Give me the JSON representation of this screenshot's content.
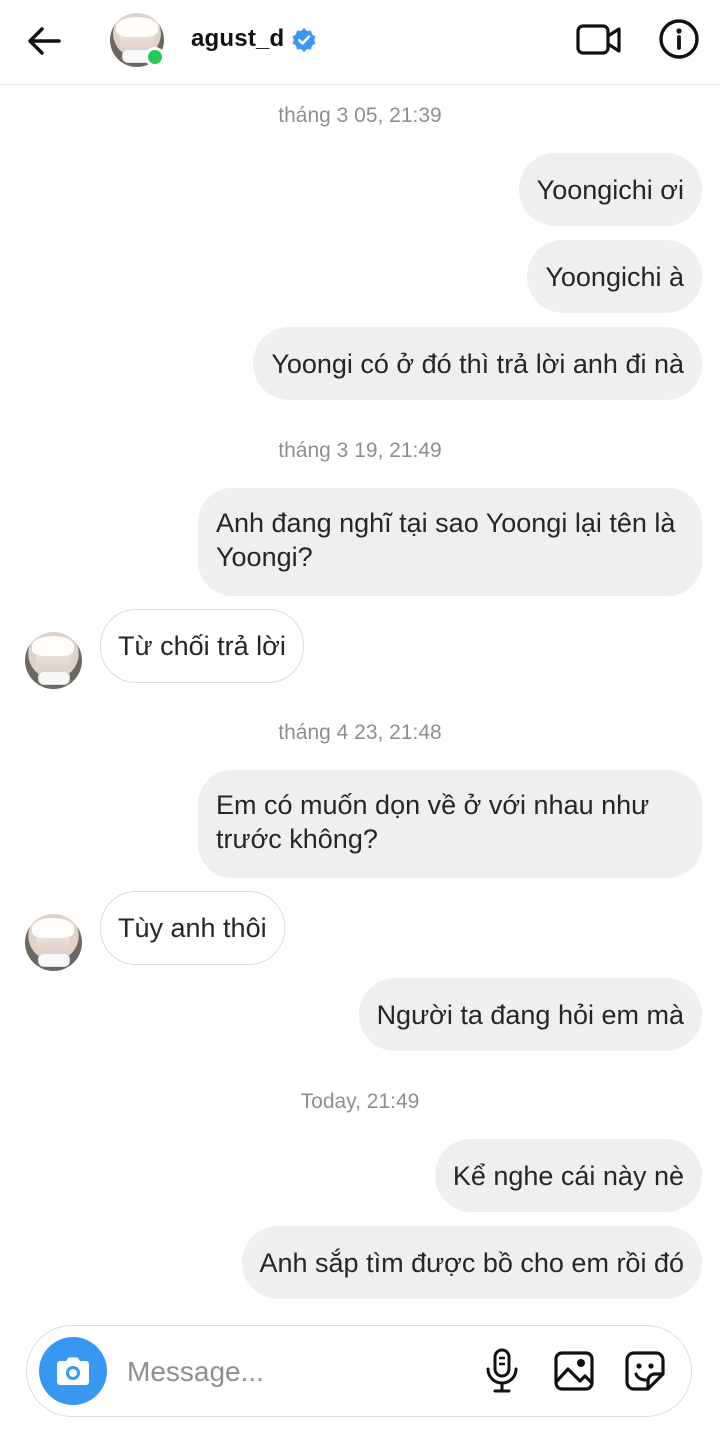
{
  "header": {
    "back_icon": "arrow-left-icon",
    "username": "agust_d",
    "verified_icon": "verified-badge-icon",
    "online_status_color": "#28c654",
    "video_icon": "video-camera-icon",
    "info_icon": "info-icon"
  },
  "conversation": [
    {
      "kind": "timestamp",
      "text": "tháng 3 05, 21:39"
    },
    {
      "kind": "sent",
      "text": "Yoongichi ơi"
    },
    {
      "kind": "sent",
      "text": "Yoongichi à"
    },
    {
      "kind": "sent",
      "text": "Yoongi có ở đó thì trả lời anh đi nà"
    },
    {
      "kind": "timestamp",
      "text": "tháng 3 19, 21:49"
    },
    {
      "kind": "sent",
      "text": "Anh đang nghĩ tại sao Yoongi lại tên là Yoongi?"
    },
    {
      "kind": "received",
      "text": "Từ chối trả lời"
    },
    {
      "kind": "timestamp",
      "text": "tháng 4 23, 21:48"
    },
    {
      "kind": "sent",
      "text": "Em có muốn dọn về ở với nhau như trước không?"
    },
    {
      "kind": "received",
      "text": "Tùy anh thôi"
    },
    {
      "kind": "sent",
      "text": "Người ta đang hỏi em mà"
    },
    {
      "kind": "timestamp",
      "text": "Today, 21:49"
    },
    {
      "kind": "sent",
      "text": "Kể nghe cái này nè"
    },
    {
      "kind": "sent",
      "text": "Anh sắp tìm được bồ cho em rồi đó"
    }
  ],
  "composer": {
    "camera_icon": "camera-icon",
    "placeholder": "Message...",
    "mic_icon": "microphone-icon",
    "gallery_icon": "gallery-icon",
    "sticker_icon": "sticker-icon"
  },
  "colors": {
    "sent_bubble": "#efefef",
    "received_bubble_border": "#dbdbdb",
    "camera_button": "#3897f0",
    "verified_badge": "#3897f0",
    "timestamp_text": "#8e8e8e"
  }
}
